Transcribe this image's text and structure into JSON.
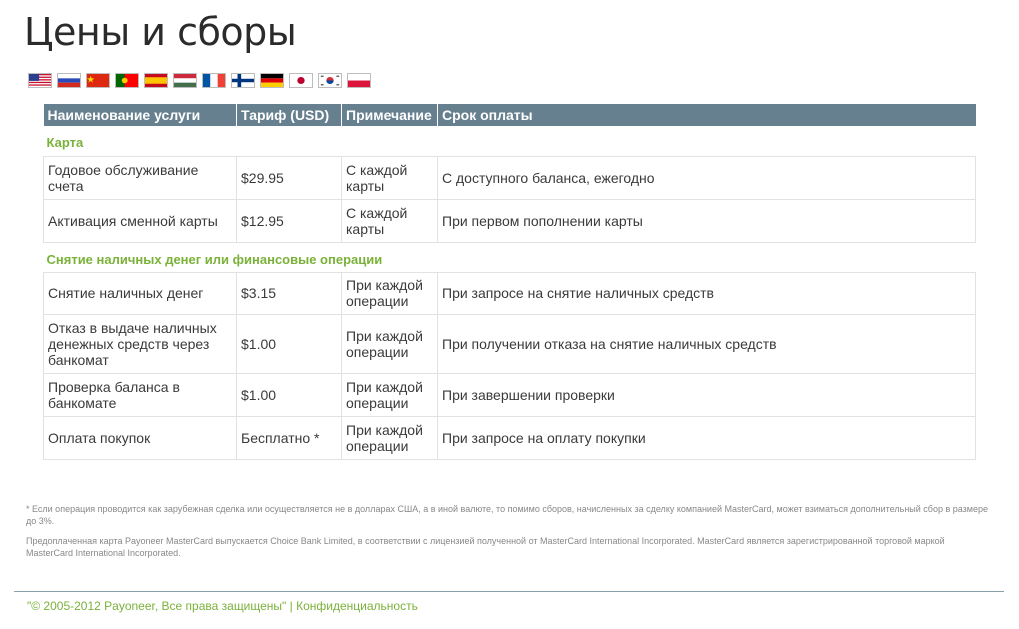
{
  "page": {
    "title": "Цены и сборы"
  },
  "flags": [
    {
      "name": "us-flag-icon"
    },
    {
      "name": "ru-flag-icon"
    },
    {
      "name": "cn-flag-icon"
    },
    {
      "name": "pt-flag-icon"
    },
    {
      "name": "es-flag-icon"
    },
    {
      "name": "hu-flag-icon"
    },
    {
      "name": "fr-flag-icon"
    },
    {
      "name": "fi-flag-icon"
    },
    {
      "name": "de-flag-icon"
    },
    {
      "name": "jp-flag-icon"
    },
    {
      "name": "kr-flag-icon"
    },
    {
      "name": "pl-flag-icon"
    }
  ],
  "table": {
    "headers": [
      "Наименование услуги",
      "Тариф (USD)",
      "Примечание",
      "Срок оплаты"
    ],
    "sections": [
      {
        "title": "Карта",
        "rows": [
          [
            "Годовое обслуживание счета",
            "$29.95",
            "С каждой карты",
            "С доступного баланса, ежегодно"
          ],
          [
            "Активация сменной карты",
            "$12.95",
            "С каждой карты",
            "При первом пополнении карты"
          ]
        ]
      },
      {
        "title": "Снятие наличных денег или финансовые операции",
        "rows": [
          [
            "Снятие наличных денег",
            "$3.15",
            "При каждой операции",
            "При запросе на снятие наличных средств"
          ],
          [
            "Отказ в выдаче наличных денежных средств через банкомат",
            "$1.00",
            "При каждой операции",
            "При получении отказа на снятие наличных средств"
          ],
          [
            "Проверка баланса в банкомате",
            "$1.00",
            "При каждой операции",
            "При завершении проверки"
          ],
          [
            "Оплата покупок",
            "Бесплатно *",
            "При каждой операции",
            "При запросе на оплату покупки"
          ]
        ]
      }
    ]
  },
  "footnotes": {
    "note1": "* Если операция проводится как зарубежная сделка или осуществляется не в долларах США, а в иной валюте, то помимо сборов, начисленных за сделку компанией MasterCard, может взиматься дополнительный сбор в размере до 3%.",
    "note2": "Предоплаченная карта Payoneer MasterCard выпускается Choice Bank Limited, в соответствии с лицензией полученной от MasterCard International Incorporated. MasterCard является зарегистрированной торговой маркой MasterCard International Incorporated."
  },
  "footer": {
    "copyright": "\"© 2005-2012 Payoneer, Все права защищены\"",
    "separator": "|",
    "privacy": "Конфиденциальность"
  },
  "colors": {
    "header_bg": "#66808f",
    "section_green": "#7ab239",
    "footer_line": "#8aa0ad"
  }
}
